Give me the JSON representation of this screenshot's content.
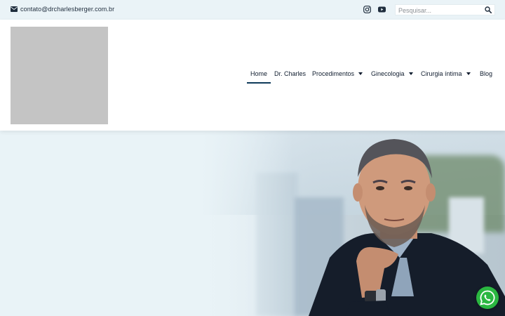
{
  "topbar": {
    "email": "contato@drcharlesberger.com.br",
    "icons": [
      "envelope-icon",
      "instagram-icon",
      "youtube-icon",
      "search-icon"
    ],
    "search": {
      "placeholder": "Pesquisar...",
      "value": ""
    }
  },
  "header": {
    "nav": [
      {
        "label": "Home",
        "active": true,
        "dropdown": false
      },
      {
        "label": "Dr. Charles",
        "active": false,
        "dropdown": false
      },
      {
        "label": "Procedimentos",
        "active": false,
        "dropdown": true
      },
      {
        "label": "Ginecologia",
        "active": false,
        "dropdown": true
      },
      {
        "label": "Cirurgia íntima",
        "active": false,
        "dropdown": true
      },
      {
        "label": "Blog",
        "active": false,
        "dropdown": false
      }
    ]
  },
  "floating": {
    "icon": "whatsapp-icon"
  },
  "colors": {
    "topbar_bg": "#eaf3f7",
    "nav_text": "#0f1c2e",
    "active_underline": "#0f3a5a",
    "whatsapp_green": "#2bb741",
    "logo_placeholder": "#c4c4c4"
  }
}
